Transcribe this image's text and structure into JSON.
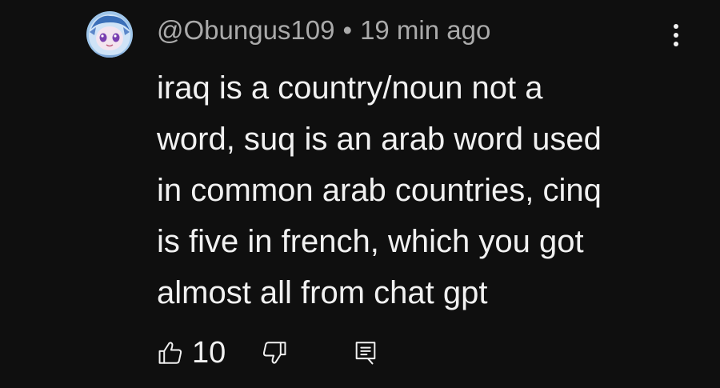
{
  "comment": {
    "author": "@Obungus109",
    "separator": "•",
    "timestamp": "19 min ago",
    "text_lines": [
      "iraq is a country/noun not a",
      "word, suq is an arab word used",
      "in common arab countries, cinq",
      "is five in french, which you got",
      "almost all from chat gpt"
    ],
    "like_count": "10"
  },
  "icons": {
    "avatar": "avatar-image",
    "more": "more-vert-icon",
    "like": "thumbs-up-icon",
    "dislike": "thumbs-down-icon",
    "reply": "reply-comment-icon"
  },
  "colors": {
    "background": "#0f0f0f",
    "text_primary": "#f1f1f1",
    "text_secondary": "#aaaaaa"
  }
}
